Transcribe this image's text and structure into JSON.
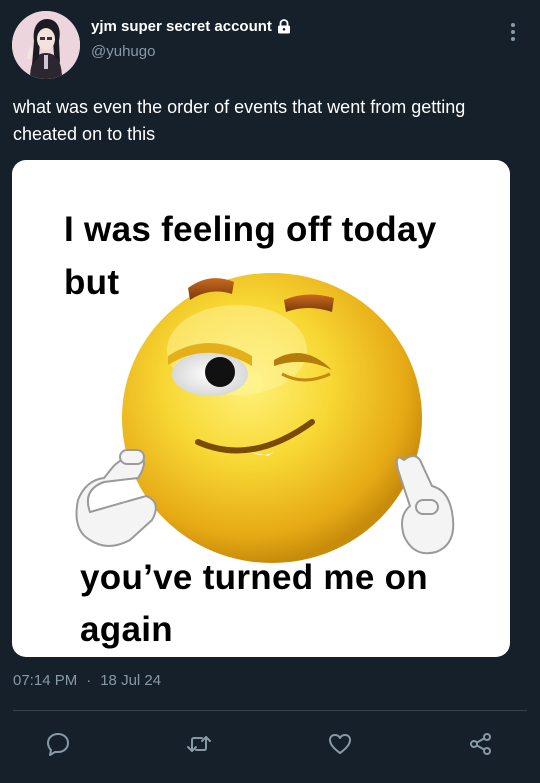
{
  "author": {
    "display_name": "yjm super secret account",
    "handle": "@yuhugo",
    "protected_icon": "lock-icon"
  },
  "menu": {
    "icon": "more-vertical-icon"
  },
  "tweet": {
    "text": "what was even the order of events that went from getting cheated on to this"
  },
  "media": {
    "caption_top_line1": "I was feeling off today",
    "caption_top_line2": "but",
    "caption_bottom_line1": "you’ve turned me on",
    "caption_bottom_line2": "again",
    "subject_icon": "winking-emoji-face"
  },
  "meta": {
    "time": "07:14 PM",
    "separator": "·",
    "date": "18 Jul 24"
  },
  "actions": [
    {
      "name": "reply",
      "icon": "reply-icon"
    },
    {
      "name": "retweet",
      "icon": "retweet-icon"
    },
    {
      "name": "like",
      "icon": "heart-icon"
    },
    {
      "name": "share",
      "icon": "share-icon"
    }
  ],
  "colors": {
    "background": "#15202b",
    "text_primary": "#ffffff",
    "text_secondary": "#8899a6",
    "divider": "#38444d"
  }
}
